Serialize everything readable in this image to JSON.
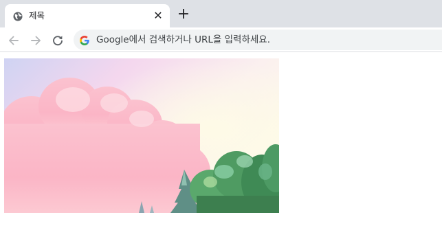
{
  "tab": {
    "title": "제목",
    "close_label": "✕",
    "favicon": "globe-icon"
  },
  "new_tab_label": "+",
  "toolbar": {
    "back_icon": "arrow-left-icon",
    "forward_icon": "arrow-right-icon",
    "reload_icon": "reload-icon"
  },
  "omnibox": {
    "icon": "google-g-icon",
    "placeholder": "Google에서 검색하거나 URL을 입력하세요."
  },
  "content": {
    "image": "pastel clouds and trees scene"
  },
  "colors": {
    "tabstrip_bg": "#dee1e6",
    "omnibox_bg": "#f1f3f4",
    "icon_gray": "#5f6368",
    "disabled_gray": "#b5b7ba"
  }
}
